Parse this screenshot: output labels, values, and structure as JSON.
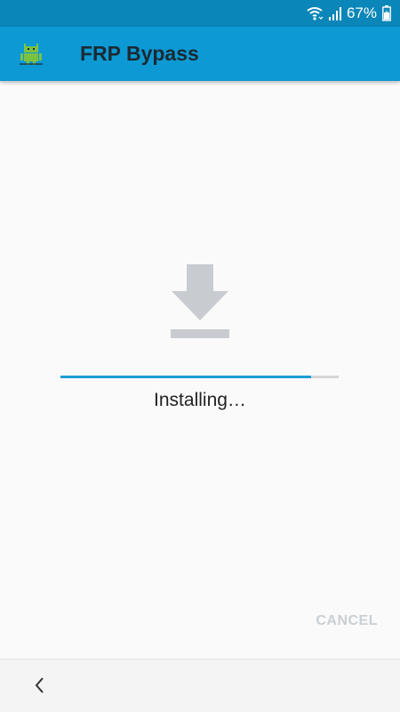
{
  "status_bar": {
    "battery_percent": "67%",
    "icons": [
      "wifi-icon",
      "signal-icon",
      "battery-icon"
    ],
    "background": "#0a86b8"
  },
  "app_bar": {
    "title": "FRP Bypass",
    "icon": "android-icon",
    "background": "#0d99d3"
  },
  "main": {
    "icon": "download-icon",
    "progress": 0.9,
    "status_text": "Installing…",
    "accent": "#1a9ed6"
  },
  "dialog": {
    "cancel_label": "CANCEL"
  },
  "nav_bar": {
    "icon": "back-icon"
  }
}
